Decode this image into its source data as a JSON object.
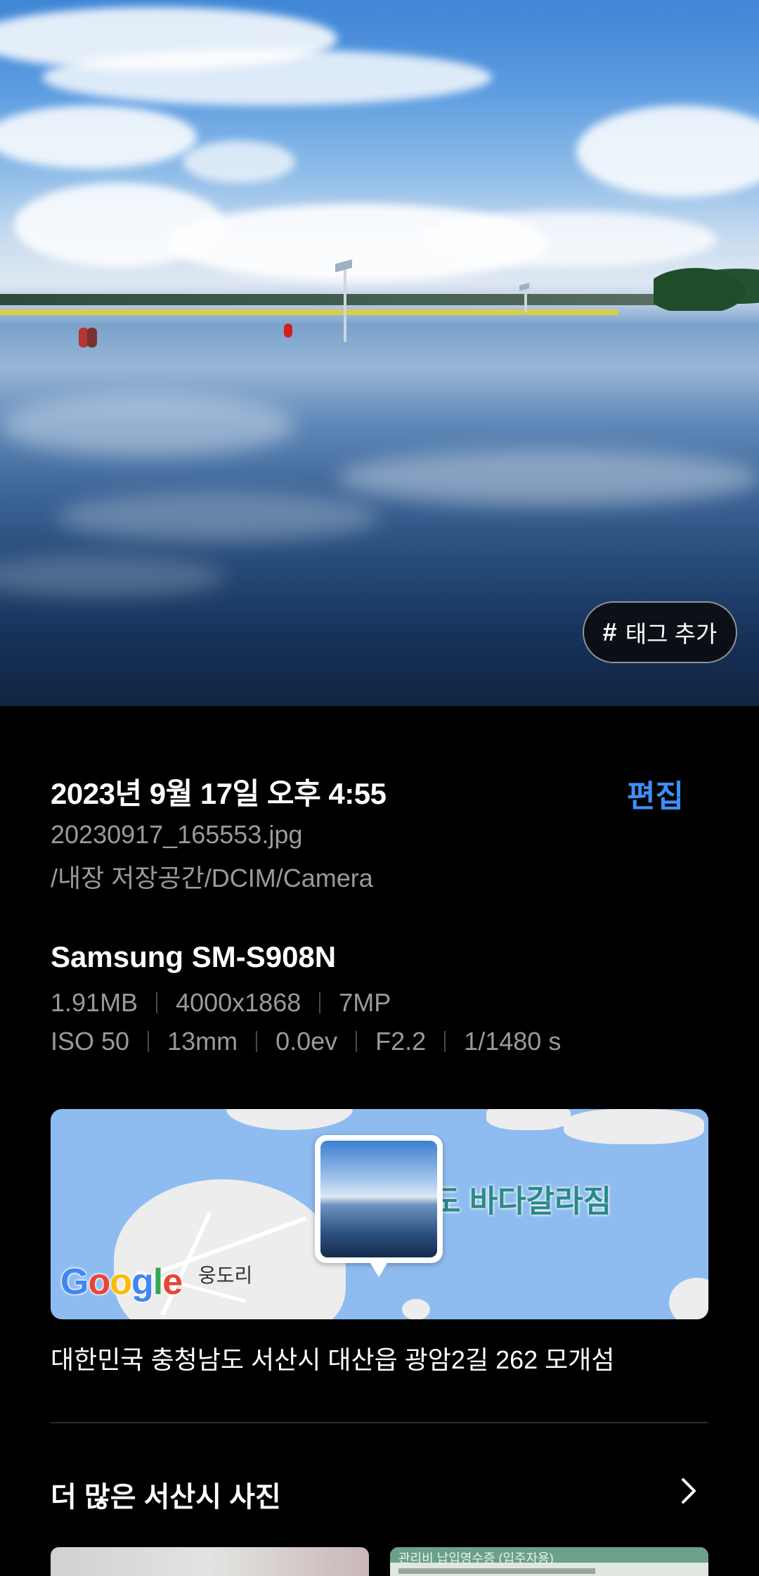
{
  "photo": {
    "tag_button": {
      "icon": "hash-icon",
      "hash": "#",
      "label": "태그 추가"
    }
  },
  "details": {
    "datetime": "2023년 9월 17일 오후 4:55",
    "edit_label": "편집",
    "filename": "20230917_165553.jpg",
    "path": "/내장 저장공간/DCIM/Camera"
  },
  "device": {
    "model": "Samsung SM-S908N",
    "row1": [
      "1.91MB",
      "4000x1868",
      "7MP"
    ],
    "row2": [
      "ISO 50",
      "13mm",
      "0.0ev",
      "F2.2",
      "1/1480 s"
    ]
  },
  "map": {
    "place_label": "도 바다갈라짐",
    "village_label": "웅도리",
    "logo_letters": [
      "G",
      "o",
      "o",
      "g",
      "l",
      "e"
    ]
  },
  "address": "대한민국 충청남도 서산시 대산읍 광암2길 262 모개섬",
  "more": {
    "title": "더 많은 서산시 사진",
    "arrow_icon": "chevron-right-icon",
    "thumb_text": "관리비 납입영수증 (입주자용)"
  },
  "colors": {
    "accent": "#3e8ef7",
    "background": "#000000",
    "secondary_text": "#9a9a9a"
  }
}
